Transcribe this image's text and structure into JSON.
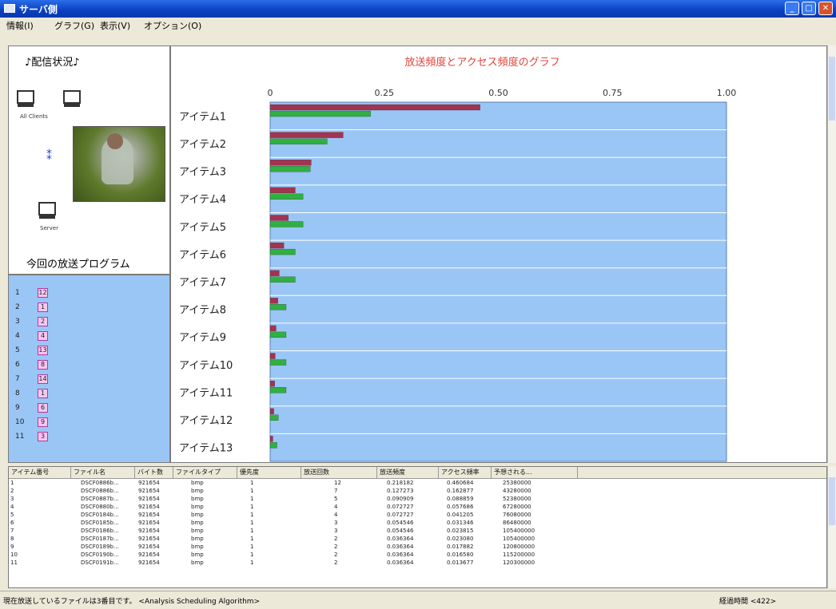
{
  "window": {
    "title": "サーバ側"
  },
  "menu": [
    "情報(I)",
    "グラフ(G)",
    "表示(V)",
    "オプション(O)"
  ],
  "left": {
    "status_title": "♪配信状況♪",
    "all_clients_label": "All Clients",
    "server_label": "Server",
    "program_title": "今回の放送プログラム"
  },
  "program": [
    {
      "n": "1",
      "v": "12"
    },
    {
      "n": "2",
      "v": "1"
    },
    {
      "n": "3",
      "v": "2"
    },
    {
      "n": "4",
      "v": "4"
    },
    {
      "n": "5",
      "v": "13"
    },
    {
      "n": "6",
      "v": "8"
    },
    {
      "n": "7",
      "v": "14"
    },
    {
      "n": "8",
      "v": "1"
    },
    {
      "n": "9",
      "v": "6"
    },
    {
      "n": "10",
      "v": "9"
    },
    {
      "n": "11",
      "v": "3"
    }
  ],
  "chart_data": {
    "type": "bar",
    "orientation": "horizontal",
    "title": "放送頻度とアクセス頻度のグラフ",
    "xlim": [
      0,
      1
    ],
    "ticks": [
      "0",
      "0.25",
      "0.50",
      "0.75",
      "1.00"
    ],
    "categories": [
      "アイテム1",
      "アイテム2",
      "アイテム3",
      "アイテム4",
      "アイテム5",
      "アイテム6",
      "アイテム7",
      "アイテム8",
      "アイテム9",
      "アイテム10",
      "アイテム11",
      "アイテム12",
      "アイテム13"
    ],
    "series": [
      {
        "values": [
          0.46,
          0.16,
          0.09,
          0.055,
          0.04,
          0.03,
          0.02,
          0.017,
          0.013,
          0.011,
          0.01,
          0.008,
          0.006
        ]
      },
      {
        "values": [
          0.22,
          0.125,
          0.088,
          0.072,
          0.072,
          0.055,
          0.055,
          0.035,
          0.035,
          0.035,
          0.035,
          0.018,
          0.015
        ]
      }
    ],
    "colors": [
      "#a33350",
      "#30b040"
    ],
    "plot_background": "#9ac6f5",
    "title_color": "#e0443a",
    "grid": true
  },
  "table": {
    "headers": [
      "アイテム番号",
      "ファイル名",
      "バイト数",
      "ファイルタイプ",
      "優先度",
      "放送回数",
      "放送頻度",
      "アクセス頻率",
      "予想される..."
    ],
    "rows": [
      [
        "1",
        "DSCF0886b...",
        "921654",
        "bmp",
        "1",
        "12",
        "0.218182",
        "0.460684",
        "25380000"
      ],
      [
        "2",
        "DSCF0886b...",
        "921654",
        "bmp",
        "1",
        "7",
        "0.127273",
        "0.162877",
        "43280000"
      ],
      [
        "3",
        "DSCF0887b...",
        "921654",
        "bmp",
        "1",
        "5",
        "0.090909",
        "0.088859",
        "52380000"
      ],
      [
        "4",
        "DSCF0880b...",
        "921654",
        "bmp",
        "1",
        "4",
        "0.072727",
        "0.057686",
        "67280000"
      ],
      [
        "5",
        "DSCF0184b...",
        "921654",
        "bmp",
        "1",
        "4",
        "0.072727",
        "0.041205",
        "76080000"
      ],
      [
        "6",
        "DSCF0185b...",
        "921654",
        "bmp",
        "1",
        "3",
        "0.054546",
        "0.031346",
        "86480000"
      ],
      [
        "7",
        "DSCF0186b...",
        "921654",
        "bmp",
        "1",
        "3",
        "0.054546",
        "0.023815",
        "105400000"
      ],
      [
        "8",
        "DSCF0187b...",
        "921654",
        "bmp",
        "1",
        "2",
        "0.036364",
        "0.023080",
        "105400000"
      ],
      [
        "9",
        "DSCF0189b...",
        "921654",
        "bmp",
        "1",
        "2",
        "0.036364",
        "0.017882",
        "120800000"
      ],
      [
        "10",
        "DSCF0190b...",
        "921654",
        "bmp",
        "1",
        "2",
        "0.036364",
        "0.016580",
        "115200000"
      ],
      [
        "11",
        "DSCF0191b...",
        "921654",
        "bmp",
        "1",
        "2",
        "0.036364",
        "0.013677",
        "120300000"
      ]
    ]
  },
  "status": {
    "message": "現在放送しているファイルは3番目です。 <Analysis Scheduling Algorithm>",
    "right": "経過時間 <422>"
  }
}
